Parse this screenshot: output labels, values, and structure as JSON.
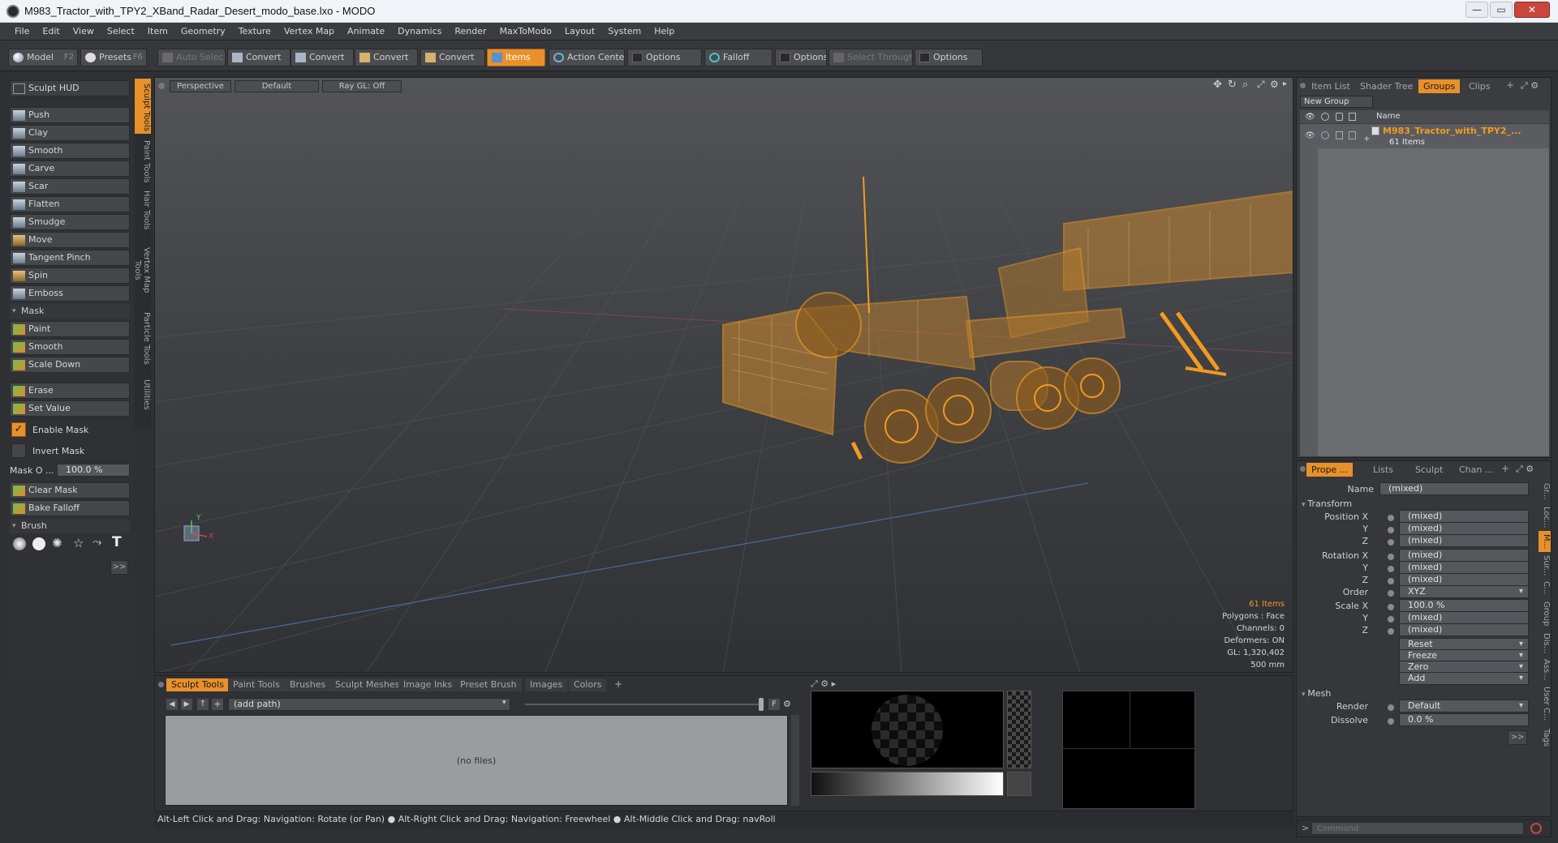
{
  "window": {
    "title": "M983_Tractor_with_TPY2_XBand_Radar_Desert_modo_base.lxo - MODO",
    "minimize": "—",
    "maximize": "▭",
    "close": "✕"
  },
  "menu": [
    "File",
    "Edit",
    "View",
    "Select",
    "Item",
    "Geometry",
    "Texture",
    "Vertex Map",
    "Animate",
    "Dynamics",
    "Render",
    "MaxToModo",
    "Layout",
    "System",
    "Help"
  ],
  "toolbar": {
    "model": "Model",
    "model_key": "F2",
    "presets": "Presets",
    "presets_key": "F6",
    "auto_select": "Auto Select",
    "convert1": "Convert",
    "convert2": "Convert",
    "convert3": "Convert",
    "convert4": "Convert",
    "items": "Items",
    "action_center": "Action Center",
    "options1": "Options",
    "falloff": "Falloff",
    "options2": "Options",
    "select_through": "Select Through",
    "options3": "Options"
  },
  "sculpt": {
    "hud": "Sculpt HUD",
    "tools": [
      "Push",
      "Clay",
      "Smooth",
      "Carve",
      "Scar",
      "Flatten",
      "Smudge",
      "Move",
      "Tangent Pinch",
      "Spin",
      "Emboss"
    ],
    "mask_section": "Mask",
    "mask_tools": [
      "Paint",
      "Smooth",
      "Scale Down"
    ],
    "erase": "Erase",
    "set_value": "Set Value",
    "enable_mask": "Enable Mask",
    "invert_mask": "Invert Mask",
    "mask_opacity_label": "Mask O ...",
    "mask_opacity_value": "100.0 %",
    "clear_mask": "Clear Mask",
    "bake_falloff": "Bake Falloff",
    "brush_section": "Brush",
    "more": ">>"
  },
  "vertical_tabs": [
    "Sculpt Tools",
    "Paint Tools",
    "Hair Tools",
    "Vertex Map Tools",
    "Particle Tools",
    "Utilities"
  ],
  "viewport": {
    "perspective": "Perspective",
    "default": "Default",
    "raygl": "Ray GL: Off",
    "stats": {
      "items": "61 Items",
      "polygons": "Polygons : Face",
      "channels": "Channels: 0",
      "deformers": "Deformers: ON",
      "gl": "GL: 1,320,402",
      "scale": "500 mm"
    },
    "axis_x": "X",
    "axis_y": "Y",
    "accent": "#f39a1e"
  },
  "bottom": {
    "tabs": [
      "Sculpt Tools",
      "Paint Tools",
      "Brushes",
      "Sculpt Meshes",
      "Image Inks",
      "Preset Brush",
      "Images",
      "Colors"
    ],
    "add": "+",
    "path": "(add path)",
    "no_files": "(no files)",
    "f_label": "F"
  },
  "status": "Alt-Left Click and Drag: Navigation: Rotate (or Pan) ● Alt-Right Click and Drag: Navigation: Freewheel ● Alt-Middle Click and Drag: navRoll",
  "items_panel": {
    "tabs": [
      "Item List",
      "Shader Tree",
      "Groups",
      "Clips"
    ],
    "new_group": "New Group",
    "name_header": "Name",
    "group_name": "M983_Tractor_with_TPY2_...",
    "group_count": "61 Items"
  },
  "properties": {
    "tabs": [
      "Prope ...",
      "Lists",
      "Sculpt",
      "Chan ..."
    ],
    "name_label": "Name",
    "name_value": "(mixed)",
    "transform": "Transform",
    "position_x_label": "Position X",
    "y_label": "Y",
    "z_label": "Z",
    "rotation_x_label": "Rotation X",
    "order_label": "Order",
    "order_value": "XYZ",
    "scale_x_label": "Scale X",
    "scale_x_value": "100.0 %",
    "mixed": "(mixed)",
    "reset": "Reset",
    "freeze": "Freeze",
    "zero": "Zero",
    "add": "Add",
    "mesh": "Mesh",
    "render_label": "Render",
    "render_value": "Default",
    "dissolve_label": "Dissolve",
    "dissolve_value": "0.0 %",
    "more": ">>",
    "side_tabs": [
      "Gr...",
      "Loc...",
      "M...",
      "Sur...",
      "C...",
      "Group",
      "Dis...",
      "Ass...",
      "User C...",
      "Tags"
    ],
    "command_placeholder": "Command"
  }
}
